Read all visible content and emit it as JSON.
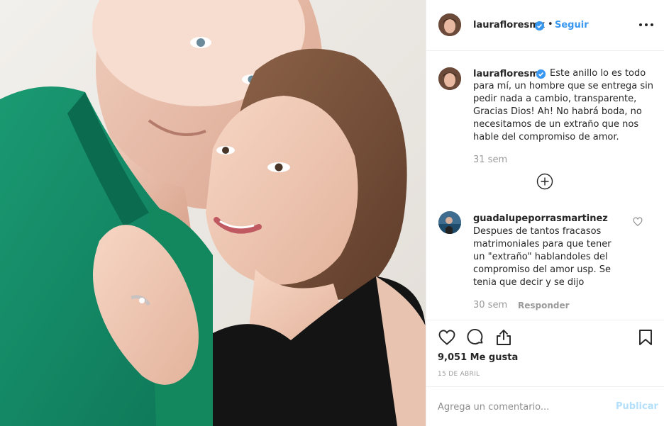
{
  "post": {
    "username": "laurafloresmx",
    "follow_label": "Seguir",
    "more_icon": "more-options-icon",
    "verified_icon": "verified-badge-icon"
  },
  "caption": {
    "username": "laurafloresmx",
    "text": "Este anillo lo es todo para mí, un hombre que se entrega sin pedir nada a cambio, transparente, Gracias Dios! Ah! No habrá boda, no necesitamos de un extraño que nos hable del compromiso de amor.",
    "time": "31 sem",
    "load_more_icon": "plus-circle-icon"
  },
  "comment": {
    "username": "guadalupeporrasmartinez",
    "text": "Despues de tantos fracasos matrimoniales para que tener un \"extraño\" hablandoles del compromiso del amor usp. Se tenia que decir y se dijo",
    "time": "30 sem",
    "reply_label": "Responder",
    "like_icon": "heart-outline-icon"
  },
  "actions": {
    "like_icon": "heart-icon",
    "comment_icon": "comment-icon",
    "share_icon": "share-icon",
    "save_icon": "bookmark-icon",
    "likes": "9,051 Me gusta",
    "date": "15 DE ABRIL"
  },
  "add_comment": {
    "placeholder": "Agrega un comentario...",
    "publish_label": "Publicar"
  },
  "colors": {
    "accent": "#3897f0",
    "muted": "#999999",
    "publish_disabled": "#b2dffc",
    "border": "#efefef"
  }
}
